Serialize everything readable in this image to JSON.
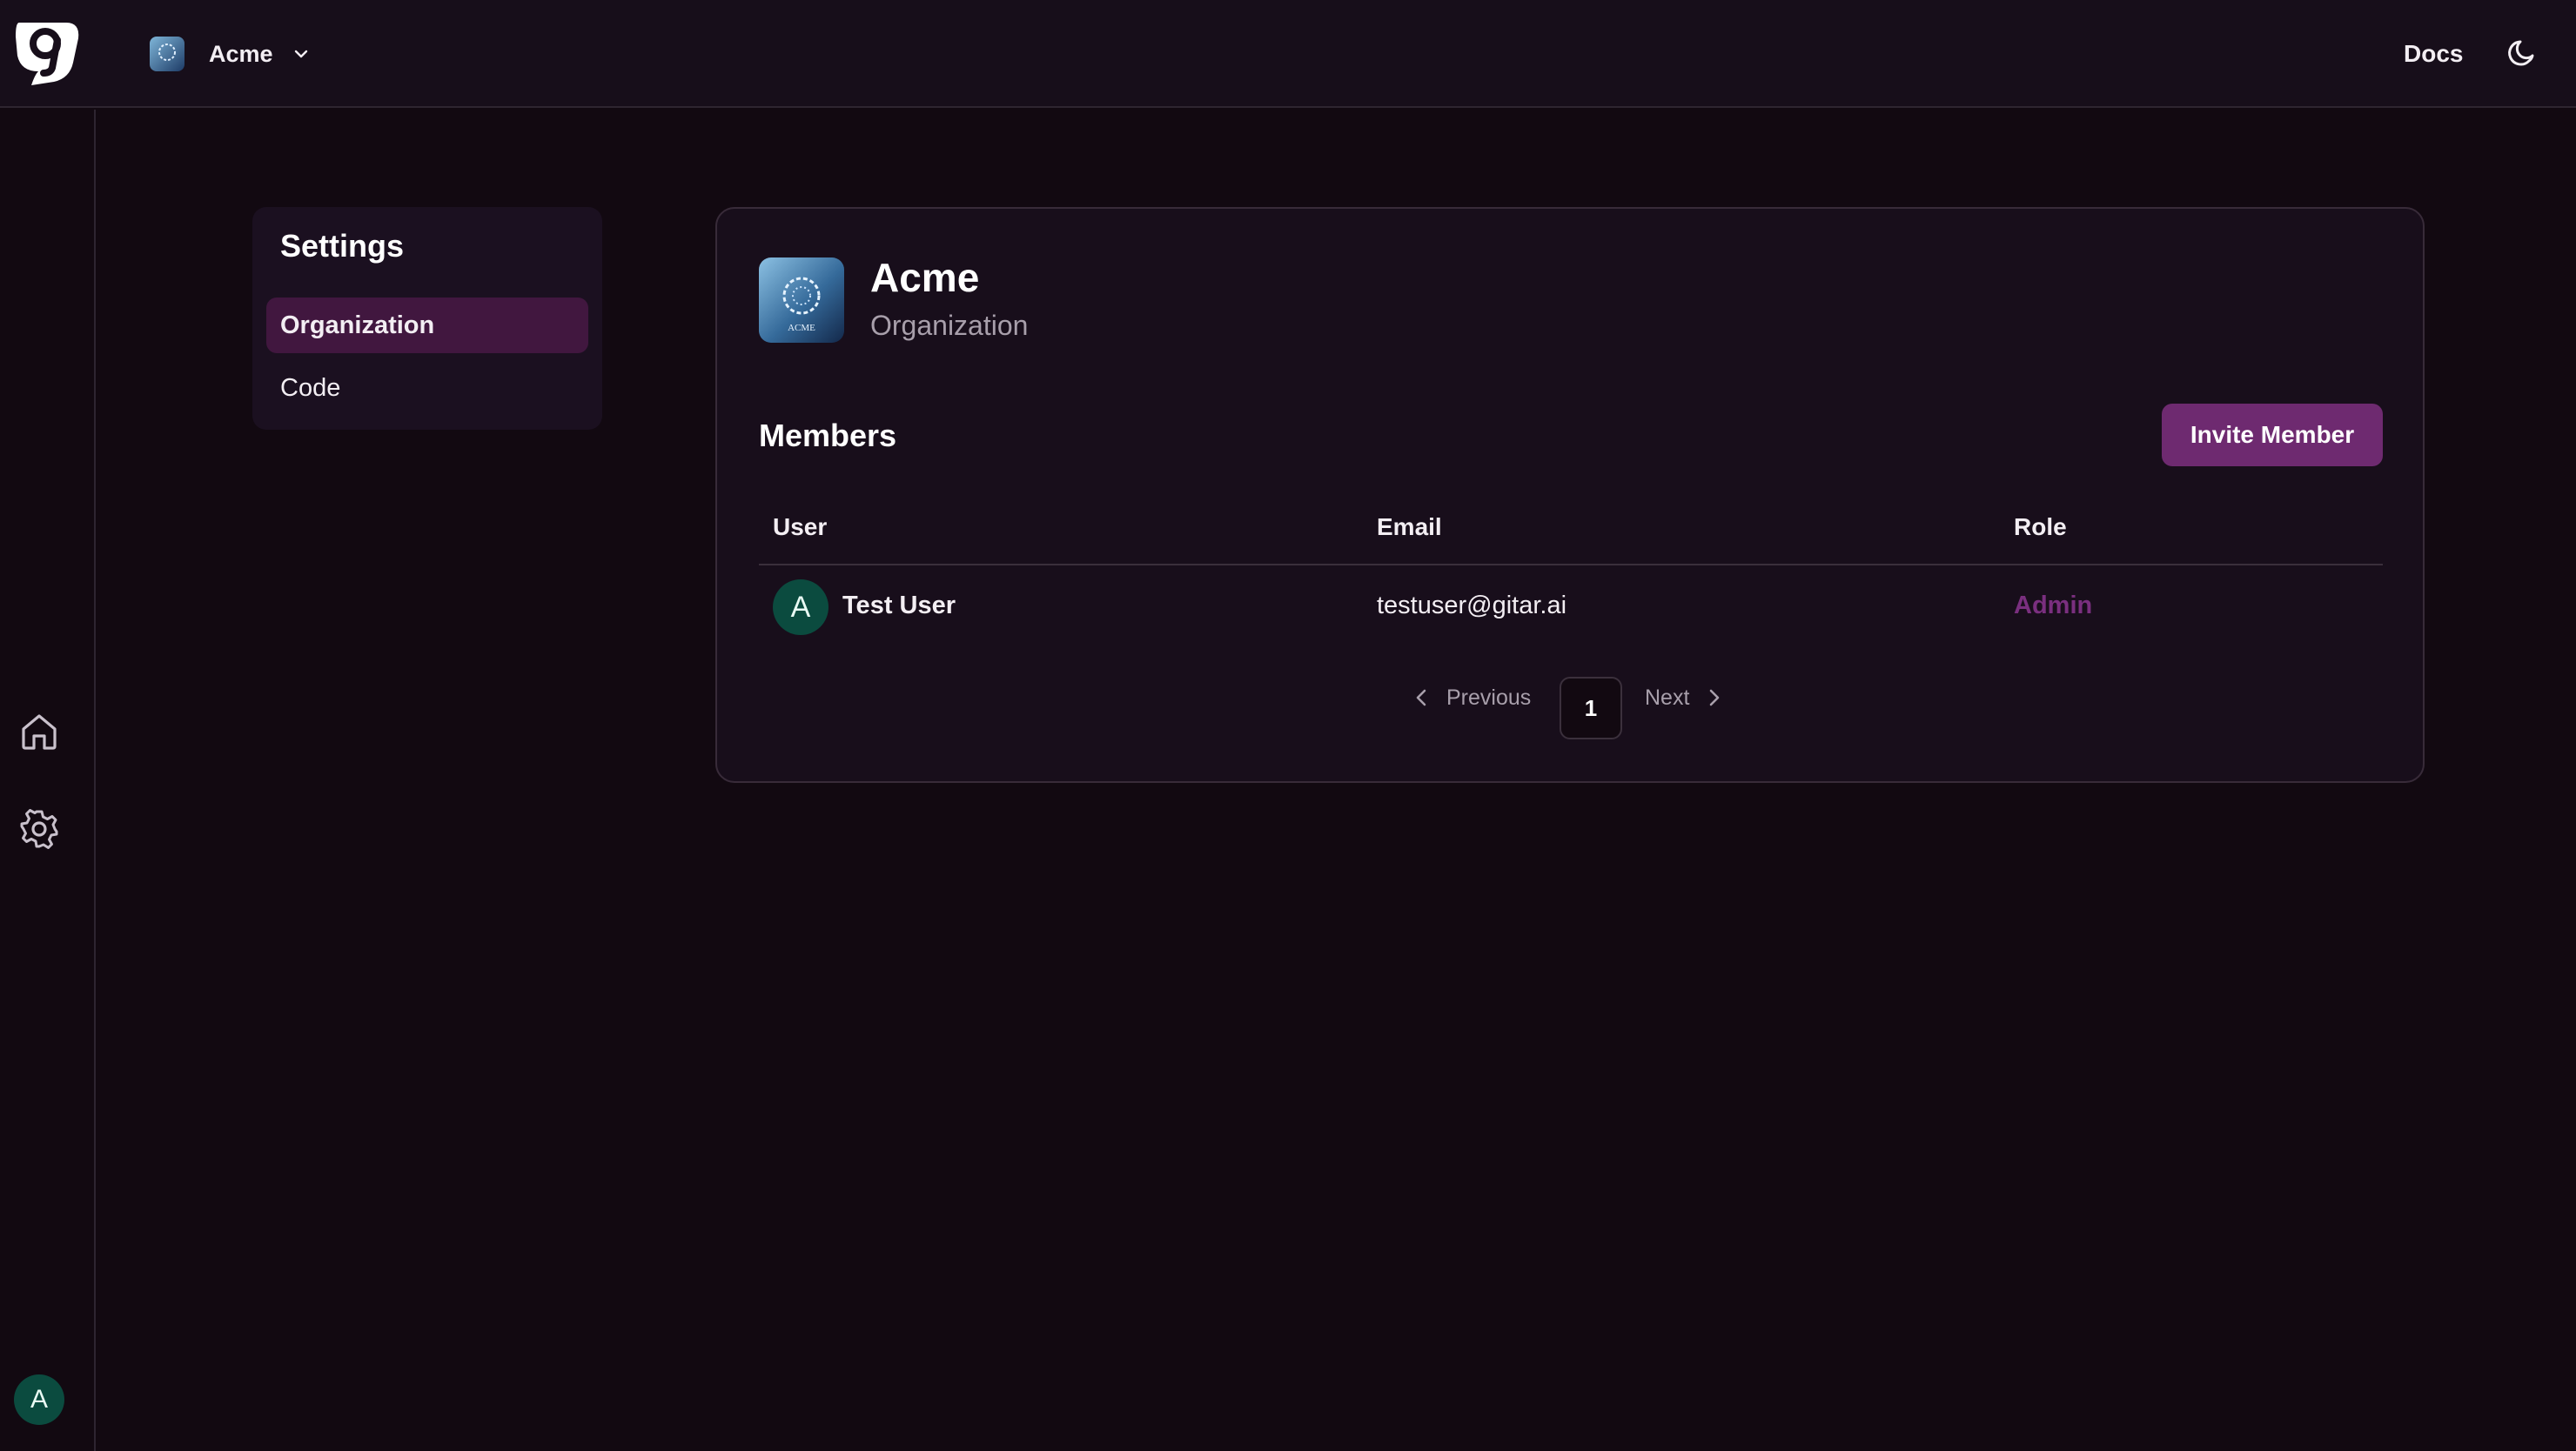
{
  "header": {
    "logo_icon": "gitar-logo-icon",
    "org_name": "Acme",
    "org_chevron_icon": "chevron-down-icon",
    "docs_label": "Docs",
    "theme_icon": "moon-icon"
  },
  "rail": {
    "items": [
      {
        "name": "home",
        "icon": "home-icon"
      },
      {
        "name": "settings",
        "icon": "gear-icon"
      }
    ],
    "user_initial": "A"
  },
  "settings_nav": {
    "title": "Settings",
    "items": [
      {
        "label": "Organization",
        "active": true
      },
      {
        "label": "Code",
        "active": false
      }
    ]
  },
  "org_card": {
    "title": "Acme",
    "subtitle": "Organization",
    "avatar_text": "ACME"
  },
  "members": {
    "heading": "Members",
    "invite_label": "Invite Member",
    "columns": [
      "User",
      "Email",
      "Role"
    ],
    "rows": [
      {
        "initial": "A",
        "name": "Test User",
        "email": "testuser@gitar.ai",
        "role": "Admin"
      }
    ]
  },
  "pagination": {
    "prev_label": "Previous",
    "current_page": "1",
    "next_label": "Next"
  },
  "colors": {
    "background": "#120911",
    "topbar": "#170e1a",
    "accent": "#6e2a70",
    "active_nav": "#41173f",
    "role_text": "#7a2f7f",
    "avatar": "#0b4b3f"
  }
}
